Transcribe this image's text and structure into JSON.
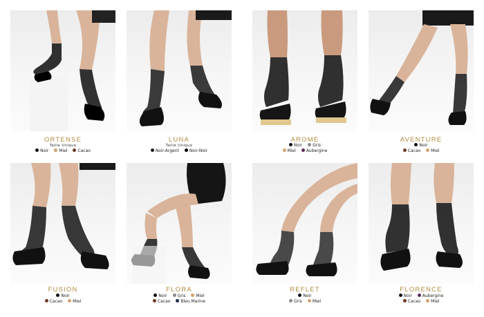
{
  "palette": {
    "Noir": "#111111",
    "Miel": "#d4a06e",
    "Cacao": "#6a3a1f",
    "Noir-Argent": "#1a1a1a",
    "Noir-Noir": "#000000",
    "Gris": "#8a8a8a",
    "Aubergine": "#5b2a55",
    "Bleu Marine": "#1d2a4a"
  },
  "products": [
    {
      "name": "ORTENSE",
      "size": "Taille Unique",
      "rows": [
        [
          "Noir",
          "Miel",
          "Cacao"
        ]
      ]
    },
    {
      "name": "LUNA",
      "size": "Taille Unique",
      "rows": [
        [
          "Noir-Argent",
          "Noir-Noir"
        ]
      ]
    },
    {
      "name": "AROME",
      "size": "",
      "rows": [
        [
          "Noir",
          "Gris"
        ],
        [
          "Miel",
          "Aubergine"
        ]
      ]
    },
    {
      "name": "AVENTURE",
      "size": "",
      "rows": [
        [
          "Noir"
        ],
        [
          "Cacao",
          "Miel"
        ]
      ]
    },
    {
      "name": "FUSION",
      "size": "",
      "rows": [
        [
          "Noir"
        ],
        [
          "Cacao",
          "Miel"
        ]
      ]
    },
    {
      "name": "FLORA",
      "size": "",
      "rows": [
        [
          "Noir",
          "Gris",
          "Miel"
        ],
        [
          "Cacao",
          "Bleu Marine"
        ]
      ]
    },
    {
      "name": "REFLET",
      "size": "",
      "rows": [
        [
          "Noir"
        ],
        [
          "Gris",
          "Miel"
        ]
      ]
    },
    {
      "name": "FLORENCE",
      "size": "",
      "rows": [
        [
          "Noir",
          "Aubergine"
        ],
        [
          "Cacao",
          "Miel"
        ]
      ]
    }
  ]
}
